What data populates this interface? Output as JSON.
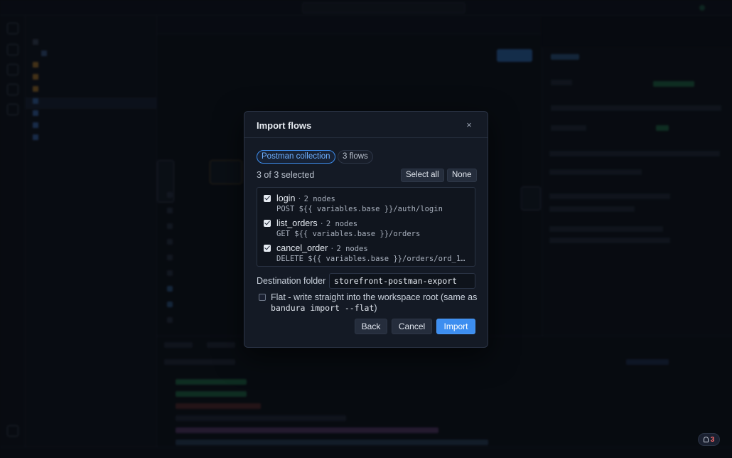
{
  "modal": {
    "title": "Import flows",
    "close_label": "×",
    "source_pill": "Postman collection",
    "count_pill": "3 flows",
    "selected_text": "3 of 3 selected",
    "select_all_label": "Select all",
    "none_label": "None",
    "flows": [
      {
        "name": "login",
        "nodes": "2 nodes",
        "command": "POST ${{ variables.base }}/auth/login",
        "checked": true
      },
      {
        "name": "list_orders",
        "nodes": "2 nodes",
        "command": "GET ${{ variables.base }}/orders",
        "checked": true
      },
      {
        "name": "cancel_order",
        "nodes": "2 nodes",
        "command": "DELETE ${{ variables.base }}/orders/ord_1…",
        "checked": true
      }
    ],
    "separator": "·",
    "destination_label": "Destination folder",
    "destination_value": "storefront-postman-export",
    "flat_text": "Flat - write straight into the workspace root (same as",
    "flat_command": "bandura import --flat",
    "flat_close": ")",
    "flat_checked": false,
    "back_label": "Back",
    "cancel_label": "Cancel",
    "import_label": "Import"
  },
  "notifications": {
    "count": "3"
  },
  "colors": {
    "accent": "#3d8ef0",
    "modal_bg": "#141a25",
    "page_bg": "#0a0d14"
  }
}
